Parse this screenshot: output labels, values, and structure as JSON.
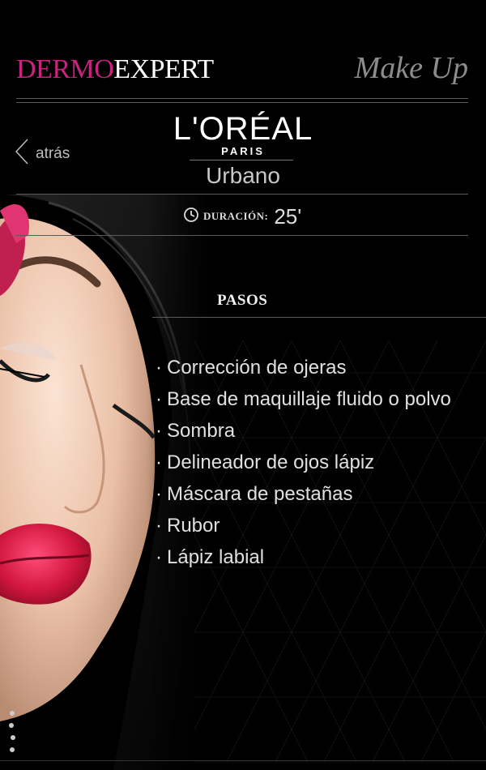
{
  "header": {
    "brand_pink": "DERMO",
    "brand_white": "EXPERT",
    "section_title": "Make Up"
  },
  "nav": {
    "back_label": "atrás"
  },
  "logo": {
    "main": "L'ORÉAL",
    "sub": "PARIS"
  },
  "look": {
    "name": "Urbano"
  },
  "duration": {
    "label": "DURACIÓN:",
    "value": "25'"
  },
  "steps": {
    "title": "PASOS",
    "items": [
      "Corrección de ojeras",
      "Base de maquillaje fluido o polvo",
      "Sombra",
      "Delineador de ojos lápiz",
      "Máscara de pestañas",
      "Rubor",
      "Lápiz labial"
    ]
  },
  "colors": {
    "accent": "#c8247e",
    "background": "#000000"
  }
}
